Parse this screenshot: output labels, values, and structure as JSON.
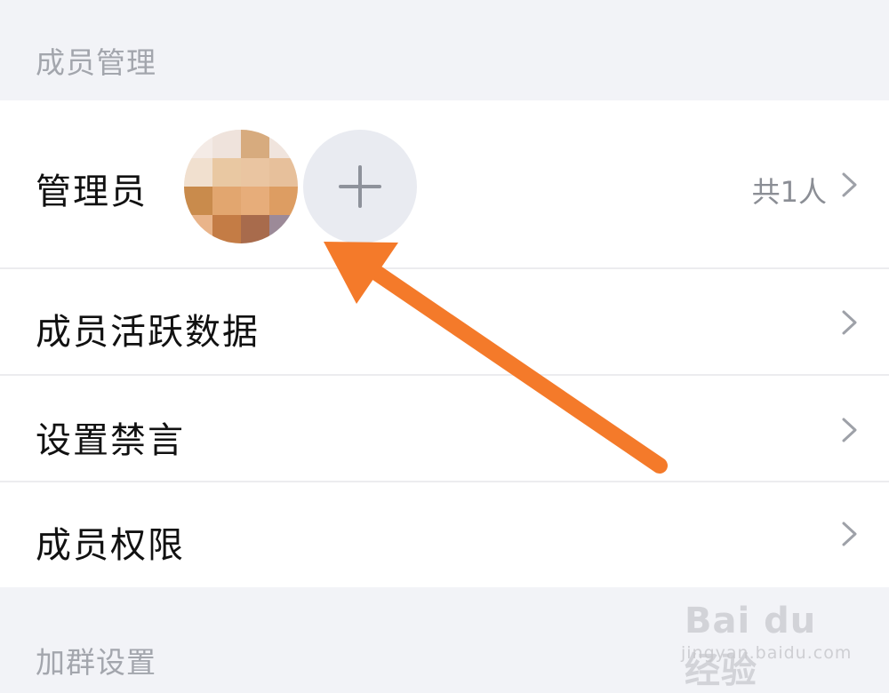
{
  "sections": {
    "member_management": "成员管理",
    "join_group_settings": "加群设置"
  },
  "admin_row": {
    "label": "管理员",
    "count": "共1人",
    "add_icon": "plus-icon",
    "chevron_icon": "chevron-right-icon"
  },
  "rows": [
    {
      "label": "成员活跃数据",
      "chevron_icon": "chevron-right-icon"
    },
    {
      "label": "设置禁言",
      "chevron_icon": "chevron-right-icon"
    },
    {
      "label": "成员权限",
      "chevron_icon": "chevron-right-icon"
    }
  ],
  "annotation": {
    "arrow_color": "#f47a2a",
    "arrow_icon": "arrow-pointer-icon"
  },
  "watermark": {
    "brand": "Bai du 经验",
    "site": "jingyan.baidu.com"
  },
  "colors": {
    "background": "#f2f3f7",
    "section_text": "#a3a6ad",
    "row_text": "#111111",
    "secondary_text": "#8b8e95",
    "add_button": "#e9ebf1"
  }
}
